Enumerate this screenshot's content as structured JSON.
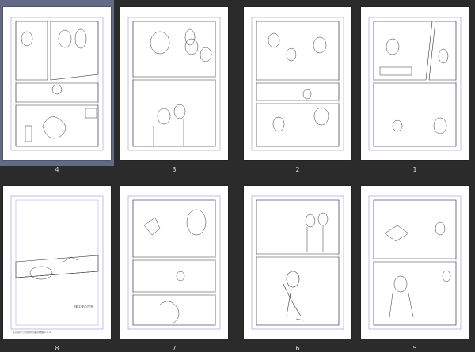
{
  "spreads": [
    {
      "left": {
        "number": "4",
        "selected": true
      },
      "right": {
        "number": "3",
        "selected": false
      }
    },
    {
      "left": {
        "number": "2",
        "selected": false
      },
      "right": {
        "number": "1",
        "selected": false
      }
    },
    {
      "left": {
        "number": "8",
        "selected": false
      },
      "right": {
        "number": "7",
        "selected": false
      }
    },
    {
      "left": {
        "number": "6",
        "selected": false
      },
      "right": {
        "number": "5",
        "selected": false
      }
    }
  ],
  "page8": {
    "text1": "僕は夢の世界",
    "footer": "ものばかりの世界の夢の物語 1-1-4"
  },
  "colors": {
    "background": "#2b2b2b",
    "selected": "#636a85",
    "page": "#ffffff",
    "guide": "#8a7fd6",
    "pencil": "#3a3a3a"
  }
}
